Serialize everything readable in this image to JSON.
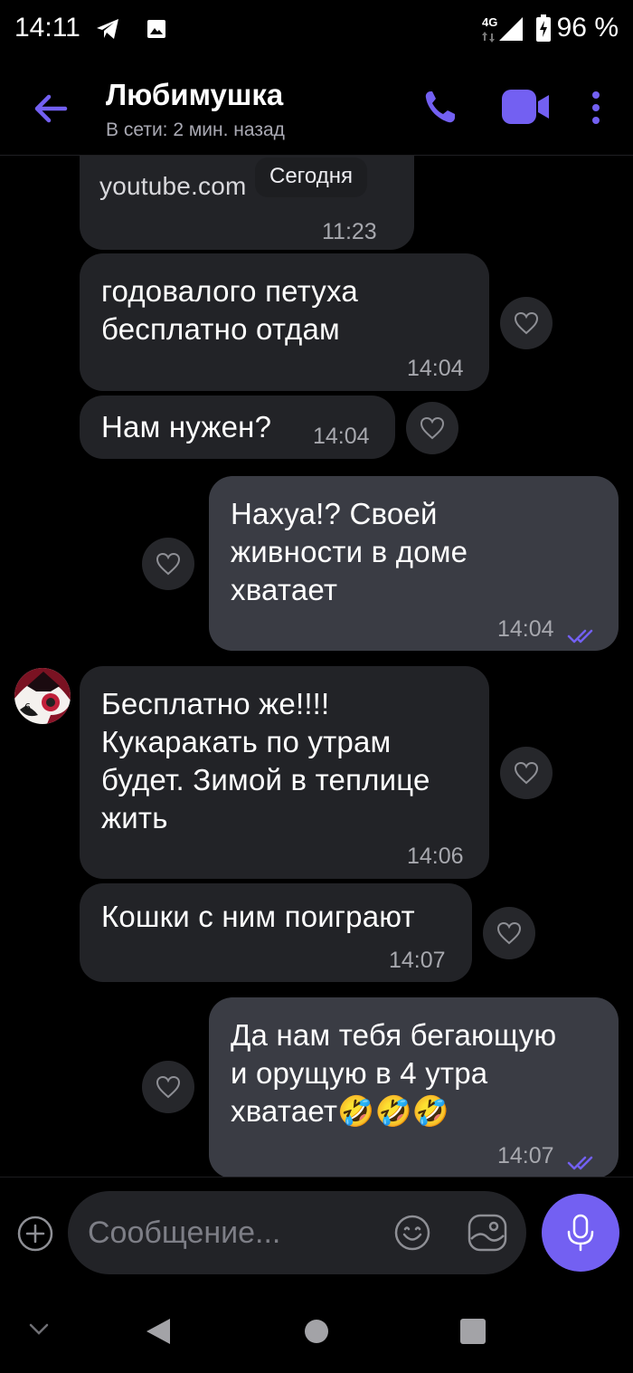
{
  "status_bar": {
    "time": "14:11",
    "network": "4G",
    "battery": "96 %",
    "icons": [
      "telegram-icon",
      "image-icon",
      "signal-icon",
      "battery-icon"
    ]
  },
  "header": {
    "title": "Любимушка",
    "status": "В сети: 2 мин. назад",
    "icons": [
      "back-arrow-icon",
      "phone-icon",
      "video-call-icon",
      "more-vert-icon"
    ]
  },
  "chat": {
    "date_pill": "Сегодня",
    "messages": [
      {
        "dir": "in",
        "text": "youtube.com",
        "time": "11:23"
      },
      {
        "dir": "in",
        "text": "годовалого петуха\nбесплатно отдам",
        "time": "14:04"
      },
      {
        "dir": "in",
        "text": "Нам нужен?",
        "time": "14:04"
      },
      {
        "dir": "out",
        "text": "Нахуа!? Своей\nживности в доме\nхватает",
        "time": "14:04"
      },
      {
        "dir": "in",
        "text": "Бесплатно же!!!!\nКукаракать  по утрам\nбудет. Зимой в теплице\nжить",
        "time": "14:06"
      },
      {
        "dir": "in",
        "text": "Кошки с ним поиграют",
        "time": "14:07"
      },
      {
        "dir": "out",
        "text": "Да нам тебя бегающую\nи орущую в 4 утра\nхватает🤣🤣🤣",
        "time": "14:07"
      }
    ]
  },
  "composer": {
    "placeholder": "Сообщение...",
    "icons": [
      "attach-plus-icon",
      "emoji-icon",
      "sticker-icon",
      "mic-icon"
    ]
  },
  "colors": {
    "accent": "#7360f2",
    "incoming_bubble": "#222327",
    "outgoing_bubble": "#3a3c44",
    "background": "#000000"
  }
}
